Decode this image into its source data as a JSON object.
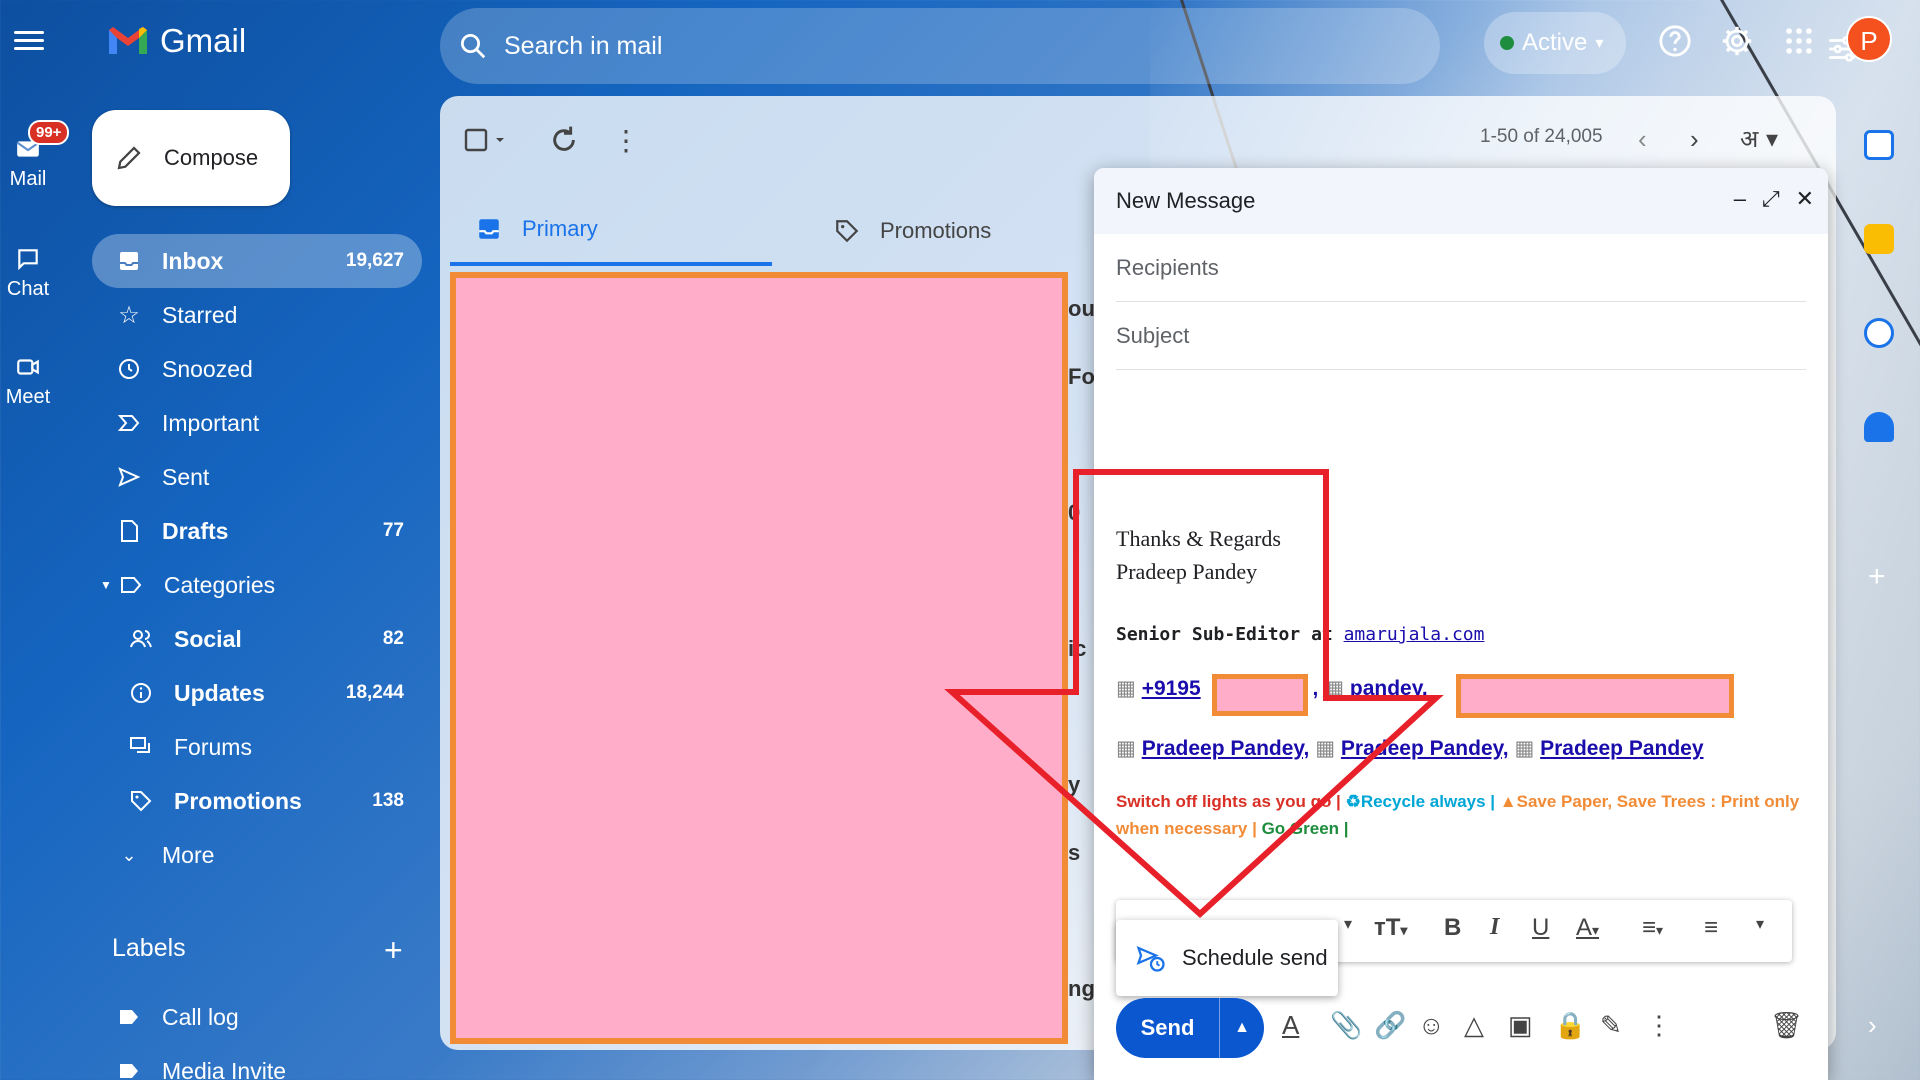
{
  "header": {
    "logo_text": "Gmail",
    "search_placeholder": "Search in mail",
    "status": "Active",
    "avatar_initial": "P"
  },
  "rail": {
    "mail_label": "Mail",
    "mail_badge": "99+",
    "chat_label": "Chat",
    "meet_label": "Meet"
  },
  "sidebar": {
    "compose_label": "Compose",
    "items": [
      {
        "label": "Inbox",
        "count": "19,627"
      },
      {
        "label": "Starred",
        "count": ""
      },
      {
        "label": "Snoozed",
        "count": ""
      },
      {
        "label": "Important",
        "count": ""
      },
      {
        "label": "Sent",
        "count": ""
      },
      {
        "label": "Drafts",
        "count": "77"
      },
      {
        "label": "Categories",
        "count": ""
      },
      {
        "label": "Social",
        "count": "82"
      },
      {
        "label": "Updates",
        "count": "18,244"
      },
      {
        "label": "Forums",
        "count": ""
      },
      {
        "label": "Promotions",
        "count": "138"
      },
      {
        "label": "More",
        "count": ""
      }
    ],
    "labels_title": "Labels",
    "label_items": [
      "Call log",
      "Media Invite"
    ]
  },
  "main": {
    "pager": "1-50 of 24,005",
    "input_tool": "अ",
    "tabs": [
      "Primary",
      "Promotions"
    ]
  },
  "compose": {
    "title": "New Message",
    "recipients_placeholder": "Recipients",
    "subject_placeholder": "Subject",
    "signature": {
      "line1": "Thanks & Regards",
      "line2": "Pradeep Pandey",
      "role_prefix": "Senior Sub-Editor at ",
      "role_link": "amarujala.com",
      "phone": "+9195",
      "email_prefix": "pandey.",
      "social_links": [
        "Pradeep Pandey,",
        "Pradeep Pandey,",
        "Pradeep Pandey"
      ],
      "green_1": "Switch off lights as you go |",
      "green_2": "Recycle always |",
      "green_3": "Save Paper, Save Trees : Print only when necessary |",
      "green_4": "Go Green |"
    },
    "schedule_send": "Schedule send",
    "send_label": "Send"
  },
  "colors": {
    "accent": "#1a73e8",
    "send": "#0b57d0",
    "redaction_fill": "#ffadc8",
    "redaction_border": "#f28b36",
    "annotation": "#e8202a"
  }
}
